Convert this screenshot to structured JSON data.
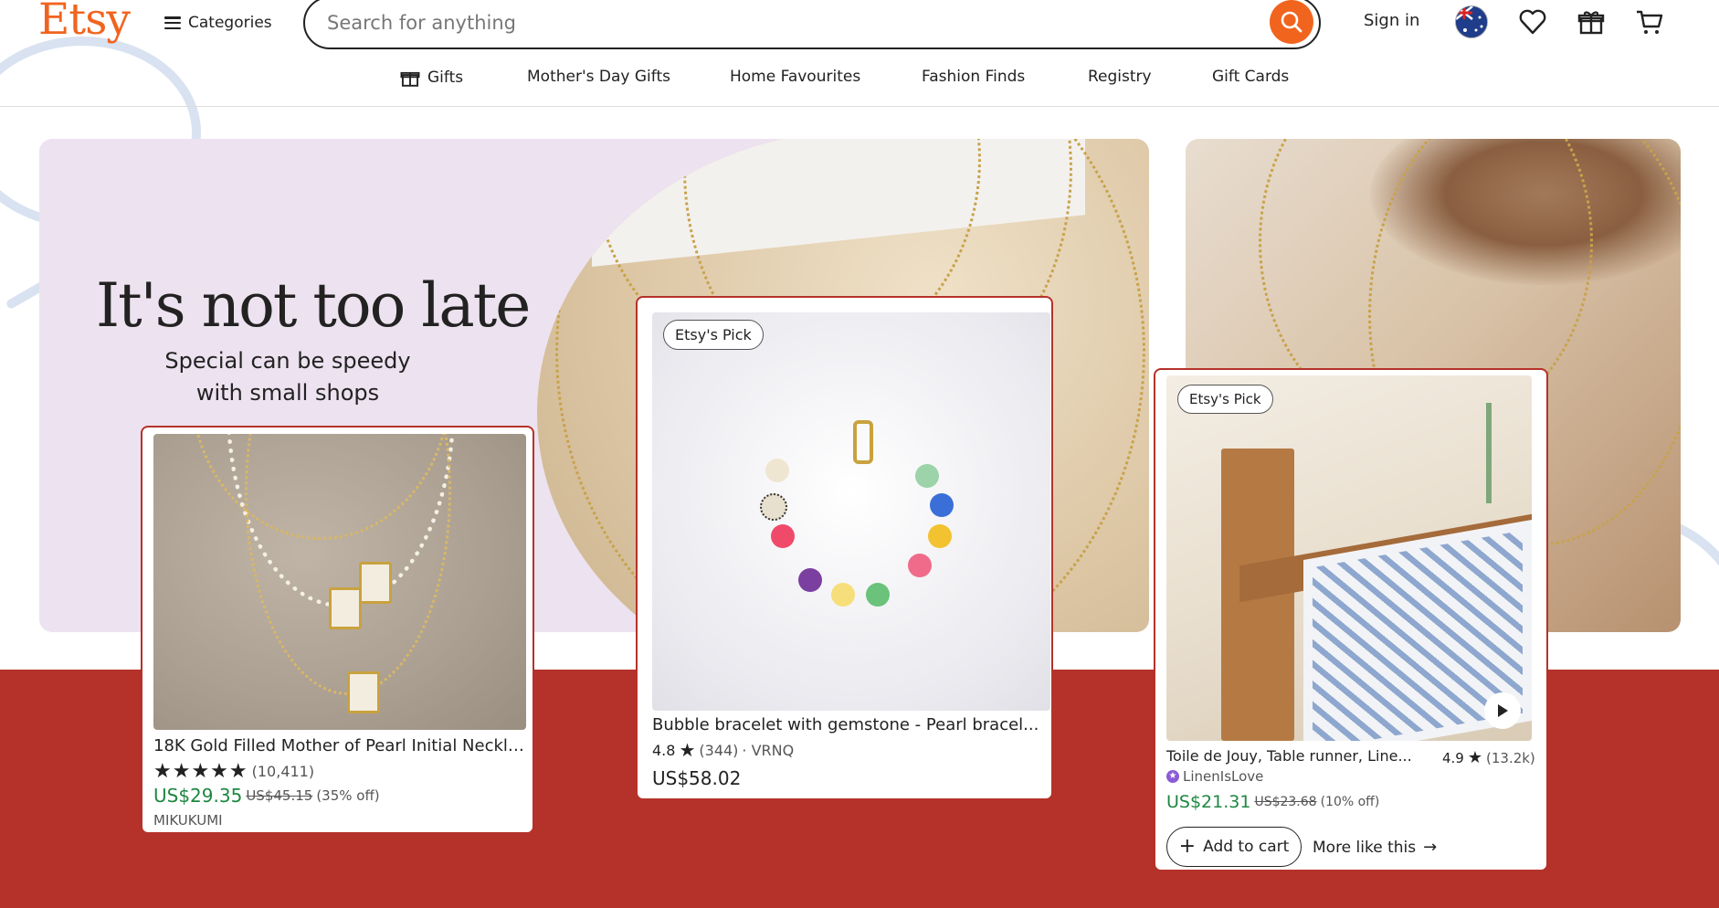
{
  "header": {
    "logo": "Etsy",
    "categories_label": "Categories",
    "search_placeholder": "Search for anything",
    "signin_label": "Sign in"
  },
  "nav": [
    {
      "label": "Gifts",
      "icon": "gift-icon"
    },
    {
      "label": "Mother's Day Gifts"
    },
    {
      "label": "Home Favourites"
    },
    {
      "label": "Fashion Finds"
    },
    {
      "label": "Registry"
    },
    {
      "label": "Gift Cards"
    }
  ],
  "hero": {
    "title": "It's not too late",
    "subtitle_line1": "Special can be speedy",
    "subtitle_line2": "with small shops"
  },
  "products": [
    {
      "title": "18K Gold Filled Mother of Pearl Initial Neckla...",
      "rating_count": "(10,411)",
      "stars": 5,
      "price": "US$29.35",
      "old_price": "US$45.15",
      "discount": "(35% off)",
      "shop": "MIKUKUMI"
    },
    {
      "badge": "Etsy's Pick",
      "title": "Bubble bracelet with gemstone - Pearl bracel...",
      "rating": "4.8",
      "rating_count": "(344)",
      "shop": "· VRNQ",
      "price": "US$58.02"
    },
    {
      "badge": "Etsy's Pick",
      "title": "Toile de Jouy, Table runner, Line...",
      "rating": "4.9",
      "rating_count": "(13.2k)",
      "shop": "LinenIsLove",
      "price": "US$21.31",
      "old_price": "US$23.68",
      "discount": "(10% off)",
      "add_to_cart": "Add to cart",
      "more_like_this": "More like this"
    }
  ],
  "colors": {
    "brand_orange": "#F1641E",
    "sale_green": "#1E8741",
    "band_red": "#B5322A",
    "hero_lilac": "#EDE2EF"
  }
}
